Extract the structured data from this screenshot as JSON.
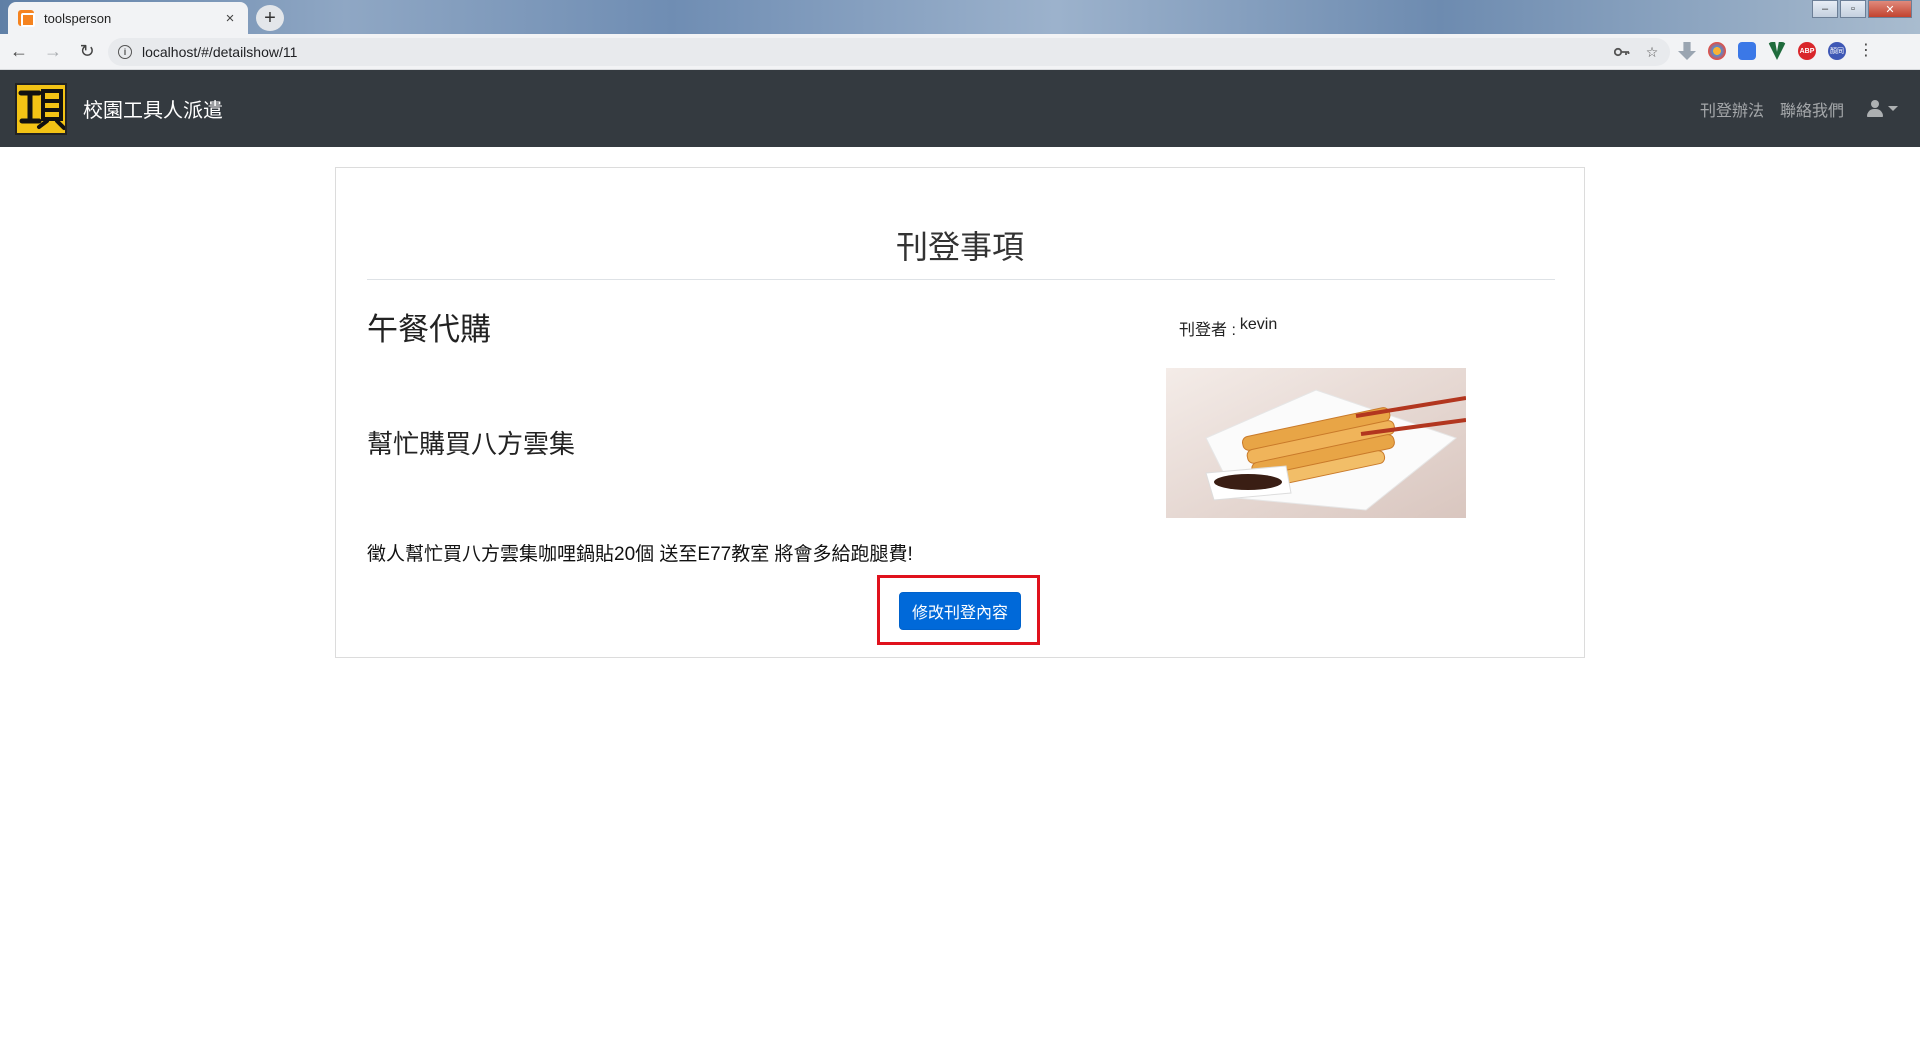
{
  "browser": {
    "tab": {
      "title": "toolsperson",
      "close": "×"
    },
    "new_tab": "+",
    "window_controls": {
      "minimize": "‒",
      "maximize": "▫",
      "close": "✕"
    },
    "nav": {
      "back": "←",
      "forward": "→",
      "reload": "↻"
    },
    "address_bar": {
      "url": "localhost/#/detailshow/11",
      "info": "i"
    },
    "omnibox_icons": [
      "key-icon",
      "star-icon"
    ],
    "extensions": [
      "download-arrow-icon",
      "chrome-extension-icon",
      "translate-icon",
      "vue-devtools-icon",
      "adblock-plus-icon",
      "profile-avatar-icon"
    ],
    "extension_labels": {
      "adblock": "ABP",
      "profile": "顏同"
    },
    "menu": "⋮"
  },
  "navbar": {
    "logo_char": "工具",
    "brand": "校園工具人派遣",
    "links": [
      "刊登辦法",
      "聯絡我們"
    ],
    "user_menu": "user-icon"
  },
  "card": {
    "heading": "刊登事項",
    "post_title": "午餐代購",
    "post_subtitle": "幫忙購買八方雲集",
    "author_label": "刊登者 :",
    "author_name": "kevin",
    "description": "徵人幫忙買八方雲集咖哩鍋貼20個 送至E77教室 將會多給跑腿費!",
    "edit_button": "修改刊登內容"
  },
  "colors": {
    "navbar_bg": "#343a40",
    "primary_button": "#0069d9",
    "highlight_box": "#e0121d",
    "logo_yellow": "#f3c315"
  }
}
